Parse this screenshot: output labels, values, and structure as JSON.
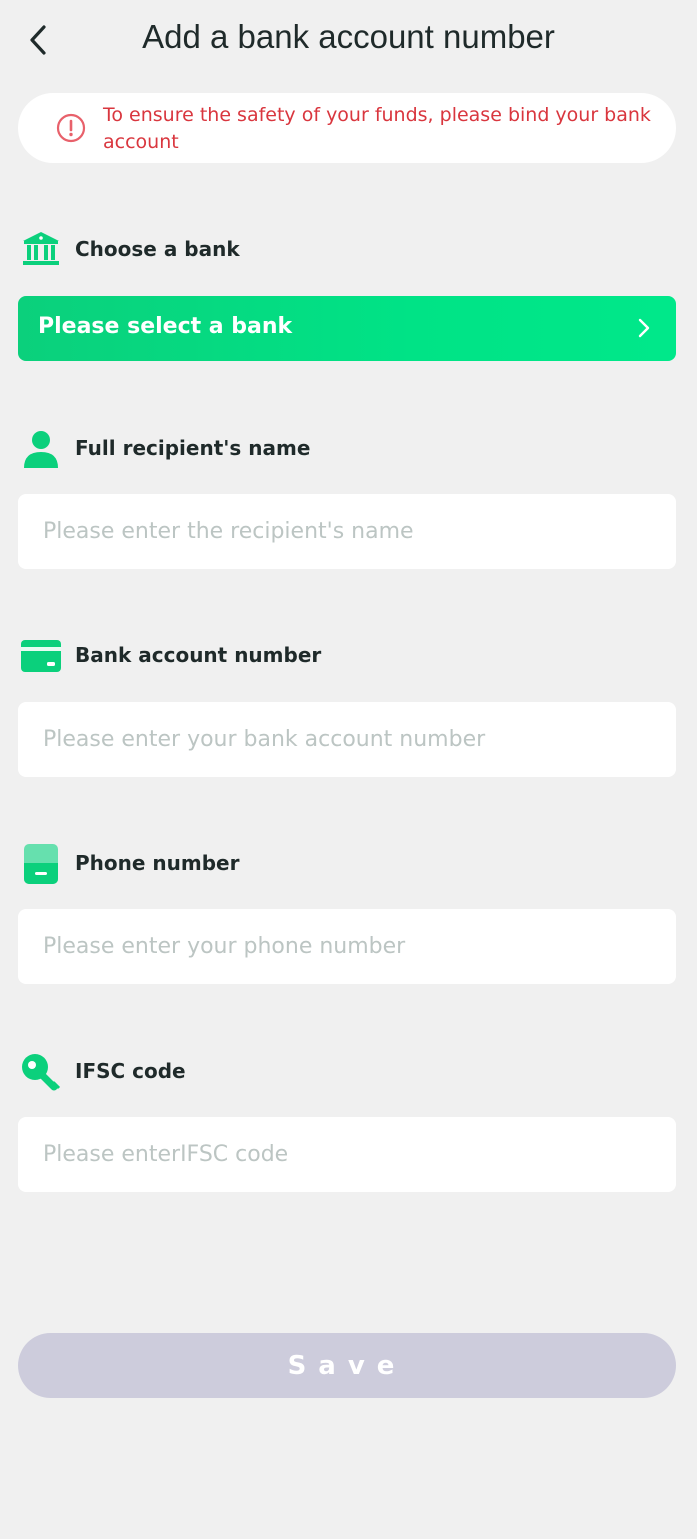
{
  "header": {
    "title": "Add a bank account number",
    "back_icon": "chevron-left-icon"
  },
  "notice": {
    "text": "To ensure the safety of your funds, please bind your bank account",
    "icon": "alert-circle-icon",
    "color": "#d9363e"
  },
  "bank": {
    "label": "Choose a bank",
    "icon": "bank-icon",
    "select_label": "Please select a bank"
  },
  "name": {
    "label": "Full recipient's name",
    "icon": "user-icon",
    "placeholder": "Please enter the recipient's name"
  },
  "account": {
    "label": "Bank account number",
    "icon": "card-icon",
    "placeholder": "Please enter your bank account number"
  },
  "phone": {
    "label": "Phone number",
    "icon": "phone-icon",
    "placeholder": "Please enter your phone number"
  },
  "ifsc": {
    "label": "IFSC code",
    "icon": "key-icon",
    "placeholder": "Please enterIFSC code"
  },
  "save": {
    "label": "Save"
  },
  "colors": {
    "accent": "#00e386",
    "background": "#f0f0f0",
    "save_disabled": "#cdccdc"
  }
}
